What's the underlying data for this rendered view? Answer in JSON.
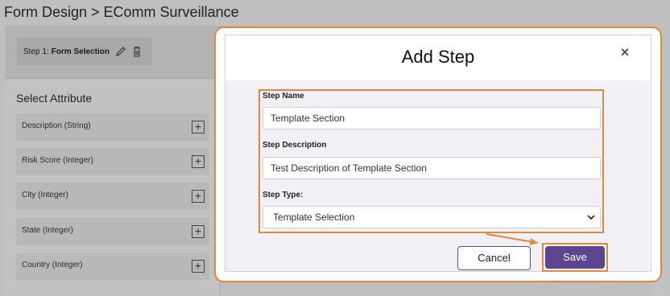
{
  "breadcrumb": "Form Design > EComm Surveillance",
  "step_chip": {
    "prefix": "Step 1:",
    "name": "Form Selection"
  },
  "attributes_panel": {
    "title": "Select Attribute",
    "items": [
      {
        "label": "Description (String)"
      },
      {
        "label": "Risk Score (Integer)"
      },
      {
        "label": "City (Integer)"
      },
      {
        "label": "State (Integer)"
      },
      {
        "label": "Country (Integer)"
      }
    ],
    "add_symbol": "+"
  },
  "modal": {
    "title": "Add Step",
    "close_symbol": "×",
    "step_name": {
      "label": "Step Name",
      "value": "Template Section"
    },
    "step_description": {
      "label": "Step Description",
      "value": "Test Description of Template Section"
    },
    "step_type": {
      "label": "Step Type:",
      "value": "Template Selection"
    },
    "cancel_label": "Cancel",
    "save_label": "Save"
  },
  "colors": {
    "highlight": "#e08a3c",
    "primary": "#5d4590"
  }
}
